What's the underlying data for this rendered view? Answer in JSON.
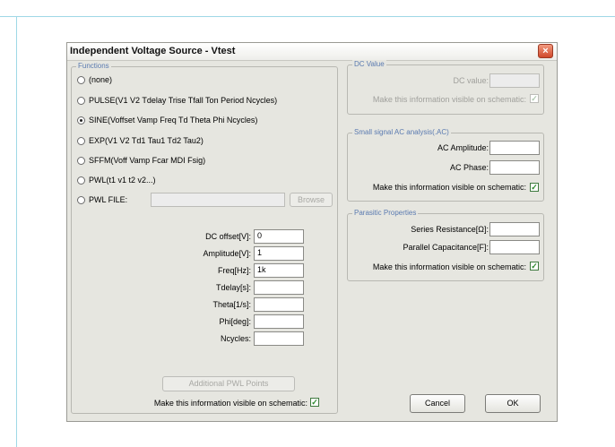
{
  "dialog": {
    "title": "Independent Voltage Source - Vtest",
    "close_glyph": "×"
  },
  "functions": {
    "title": "Functions",
    "options": [
      "(none)",
      "PULSE(V1 V2 Tdelay Trise Tfall Ton Period Ncycles)",
      "SINE(Voffset Vamp Freq Td Theta Phi Ncycles)",
      "EXP(V1 V2 Td1 Tau1 Td2 Tau2)",
      "SFFM(Voff Vamp Fcar MDI Fsig)",
      "PWL(t1 v1 t2 v2...)",
      "PWL FILE:"
    ],
    "selected": "SINE(Voffset Vamp Freq Td Theta Phi Ncycles)",
    "browse_label": "Browse",
    "params": [
      {
        "label": "DC offset[V]:",
        "value": "0"
      },
      {
        "label": "Amplitude[V]:",
        "value": "1"
      },
      {
        "label": "Freq[Hz]:",
        "value": "1k"
      },
      {
        "label": "Tdelay[s]:",
        "value": ""
      },
      {
        "label": "Theta[1/s]:",
        "value": ""
      },
      {
        "label": "Phi[deg]:",
        "value": ""
      },
      {
        "label": "Ncycles:",
        "value": ""
      }
    ],
    "additional_label": "Additional PWL Points",
    "visible_label": "Make this information visible on schematic:"
  },
  "dc_value": {
    "title": "DC Value",
    "dc_label": "DC value:",
    "dc_value": "",
    "visible_label": "Make this information visible on schematic:"
  },
  "ac": {
    "title": "Small signal AC analysis(.AC)",
    "amplitude_label": "AC Amplitude:",
    "amplitude_value": "",
    "phase_label": "AC Phase:",
    "phase_value": "",
    "visible_label": "Make this information visible on schematic:"
  },
  "parasitic": {
    "title": "Parasitic Properties",
    "resistance_label": "Series Resistance[Ω]:",
    "resistance_value": "",
    "capacitance_label": "Parallel Capacitance[F]:",
    "capacitance_value": "",
    "visible_label": "Make this information visible on schematic:"
  },
  "buttons": {
    "cancel": "Cancel",
    "ok": "OK"
  },
  "check_glyph": "✓",
  "icons": {
    "close": "close-icon",
    "radio": "radio-icon",
    "checkbox": "checkbox-icon"
  },
  "colors": {
    "group_title": "#5a7ab0",
    "checkbox_check": "#2c8a2c",
    "close_button": "#d0482a"
  }
}
